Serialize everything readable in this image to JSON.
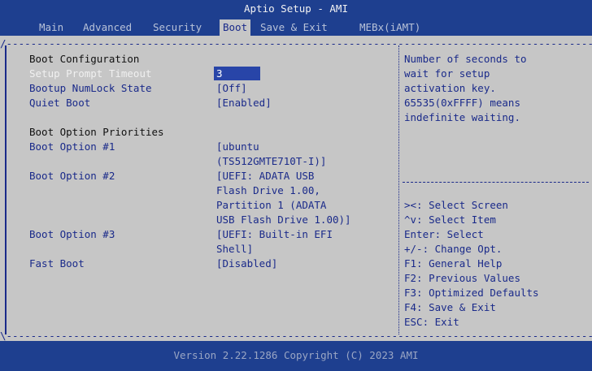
{
  "title": "Aptio Setup - AMI",
  "tabs": [
    "Main",
    "Advanced",
    "Security",
    "Boot",
    "Save & Exit",
    "MEBx(iAMT)"
  ],
  "active_tab": "Boot",
  "settings": {
    "boot_configuration": "Boot Configuration",
    "setup_prompt_timeout": {
      "label": "Setup Prompt Timeout",
      "value": "3"
    },
    "bootup_numlock": {
      "label": "Bootup NumLock State",
      "value": "[Off]"
    },
    "quiet_boot": {
      "label": "Quiet Boot",
      "value": "[Enabled]"
    },
    "boot_option_priorities": "Boot Option Priorities",
    "boot_option_1": {
      "label": "Boot Option #1",
      "value_lines": [
        "[ubuntu",
        "(TS512GMTE710T-I)]"
      ]
    },
    "boot_option_2": {
      "label": "Boot Option #2",
      "value_lines": [
        "[UEFI: ADATA USB",
        "Flash Drive 1.00,",
        "Partition 1 (ADATA",
        "USB Flash Drive 1.00)]"
      ]
    },
    "boot_option_3": {
      "label": "Boot Option #3",
      "value_lines": [
        "[UEFI: Built-in EFI",
        "Shell]"
      ]
    },
    "fast_boot": {
      "label": "Fast Boot",
      "value": "[Disabled]"
    }
  },
  "help_text": [
    "Number of seconds to",
    "wait for setup",
    "activation key.",
    "65535(0xFFFF) means",
    "indefinite waiting."
  ],
  "key_help": [
    "><: Select Screen",
    "^v: Select Item",
    "Enter: Select",
    "+/-: Change Opt.",
    "F1: General Help",
    "F2: Previous Values",
    "F3: Optimized Defaults",
    "F4: Save & Exit",
    "ESC: Exit"
  ],
  "version": "Version 2.22.1286 Copyright (C) 2023 AMI",
  "colors": {
    "header_bg": "#1e3f8f",
    "body_bg": "#c6c6c6",
    "text": "#1a2a8a",
    "highlight": "#2845a8"
  }
}
